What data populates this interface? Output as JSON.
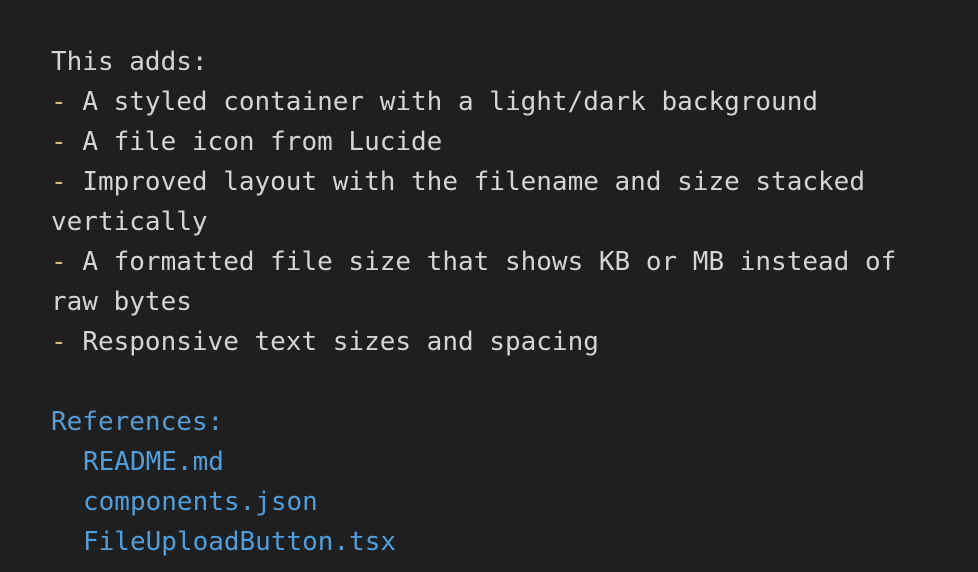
{
  "intro": "This adds:",
  "bullet_marker": "-",
  "bullets": [
    {
      "lines": [
        "A styled container with a light/dark background"
      ]
    },
    {
      "lines": [
        "A file icon from Lucide"
      ]
    },
    {
      "lines": [
        "Improved layout with the filename and size stacked",
        "vertically"
      ]
    },
    {
      "lines": [
        "A formatted file size that shows KB or MB instead of",
        "raw bytes"
      ]
    },
    {
      "lines": [
        "Responsive text sizes and spacing"
      ]
    }
  ],
  "references": {
    "heading": "References:",
    "files": [
      "README.md",
      "components.json",
      "FileUploadButton.tsx"
    ]
  },
  "colors": {
    "background": "#1f1f1f",
    "text": "#d4d4d4",
    "bullet_marker": "#d7ba7d",
    "reference_heading": "#569cd6",
    "reference_link": "#4f9fde"
  }
}
